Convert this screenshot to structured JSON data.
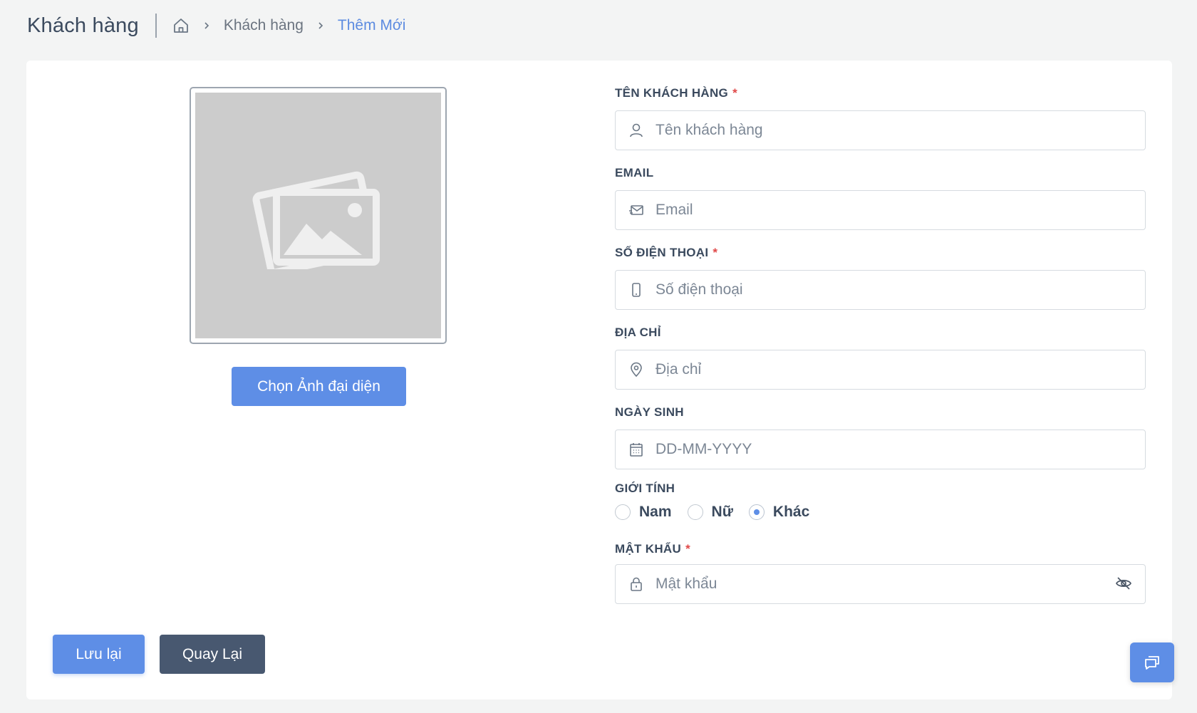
{
  "header": {
    "title": "Khách hàng",
    "breadcrumb": [
      {
        "label": "Khách hàng"
      },
      {
        "label": "Thêm Mới"
      }
    ]
  },
  "avatar": {
    "choose_label": "Chọn Ảnh đại diện"
  },
  "form": {
    "name": {
      "label": "TÊN KHÁCH HÀNG",
      "required": "*",
      "placeholder": "Tên khách hàng",
      "value": ""
    },
    "email": {
      "label": "EMAIL",
      "placeholder": "Email",
      "value": ""
    },
    "phone": {
      "label": "SỐ ĐIỆN THOẠI",
      "required": "*",
      "placeholder": "Số điện thoại",
      "value": ""
    },
    "address": {
      "label": "ĐỊA CHỈ",
      "placeholder": "Địa chỉ",
      "value": ""
    },
    "birthday": {
      "label": "NGÀY SINH",
      "placeholder": "DD-MM-YYYY",
      "value": ""
    },
    "gender": {
      "label": "GIỚI TÍNH",
      "options": [
        {
          "label": "Nam",
          "checked": false
        },
        {
          "label": "Nữ",
          "checked": false
        },
        {
          "label": "Khác",
          "checked": true
        }
      ]
    },
    "password": {
      "label": "MẬT KHẨU",
      "required": "*",
      "placeholder": "Mật khẩu",
      "value": ""
    }
  },
  "actions": {
    "save_label": "Lưu lại",
    "back_label": "Quay Lại"
  },
  "icons": {
    "home": "home-icon",
    "user": "user-icon",
    "email": "mail-icon",
    "phone": "phone-icon",
    "address": "map-pin-icon",
    "birthday": "calendar-icon",
    "password": "lock-icon",
    "visibility": "eye-off-icon",
    "chat": "chat-icon",
    "image": "image-placeholder-icon"
  },
  "colors": {
    "primary": "#5e8ee6",
    "secondary": "#485870",
    "required": "#e04848",
    "background": "#f3f4f4"
  }
}
